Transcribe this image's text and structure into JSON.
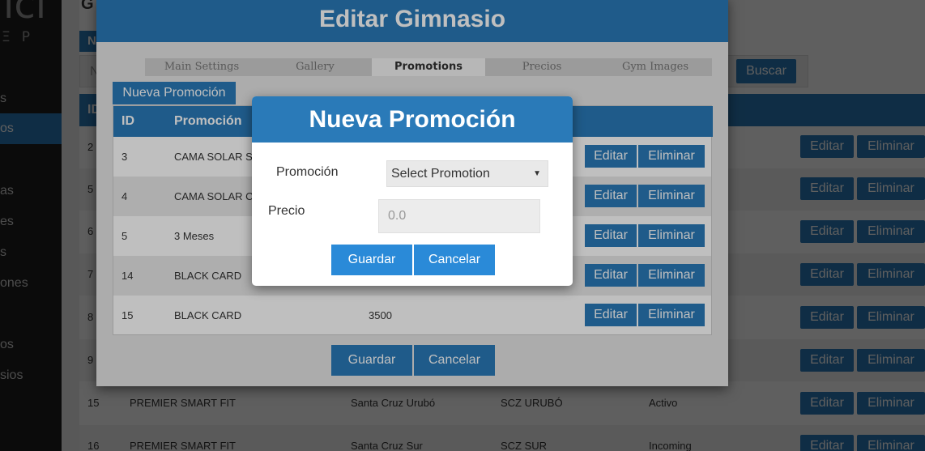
{
  "background": {
    "title": "G",
    "filter_button": "N",
    "filter_placeholder": "N",
    "search_label": "Buscar",
    "table_header_id": "ID",
    "sidebar_items": [
      "s",
      "os",
      "as",
      "es",
      "s",
      "ones",
      "os",
      "sios"
    ],
    "rows": [
      {
        "id": "2",
        "name": "",
        "city": "",
        "code": "",
        "status": ""
      },
      {
        "id": "5",
        "name": "",
        "city": "",
        "code": "",
        "status": ""
      },
      {
        "id": "6",
        "name": "",
        "city": "",
        "code": "",
        "status": ""
      },
      {
        "id": "7",
        "name": "",
        "city": "",
        "code": "",
        "status": ""
      },
      {
        "id": "8",
        "name": "",
        "city": "",
        "code": "",
        "status": ""
      },
      {
        "id": "9",
        "name": "",
        "city": "",
        "code": "",
        "status": ""
      },
      {
        "id": "15",
        "name": "PREMIER SMART FIT",
        "city": "Santa Cruz Urubó",
        "code": "SCZ URUBÓ",
        "status": "Activo"
      },
      {
        "id": "16",
        "name": "PREMIER SMART FIT",
        "city": "Santa Cruz Sur",
        "code": "SCZ SUR",
        "status": "Incoming"
      }
    ],
    "edit_label": "Editar",
    "delete_label": "Eliminar"
  },
  "edit_modal": {
    "title": "Editar Gimnasio",
    "tabs": [
      "Main Settings",
      "Gallery",
      "Promotions",
      "Precios",
      "Gym Images"
    ],
    "active_tab": "Promotions",
    "new_button": "Nueva Promoción",
    "headers": {
      "id": "ID",
      "promo": "Promoción"
    },
    "rows": [
      {
        "id": "3",
        "promo": "CAMA SOLAR S",
        "price": ""
      },
      {
        "id": "4",
        "promo": "CAMA SOLAR C",
        "price": ""
      },
      {
        "id": "5",
        "promo": "3 Meses",
        "price": ""
      },
      {
        "id": "14",
        "promo": "BLACK CARD",
        "price": ""
      },
      {
        "id": "15",
        "promo": "BLACK CARD",
        "price": "3500"
      }
    ],
    "edit_label": "Editar",
    "delete_label": "Eliminar",
    "save_label": "Guardar",
    "cancel_label": "Cancelar"
  },
  "promo_modal": {
    "title": "Nueva Promoción",
    "promo_label": "Promoción",
    "promo_select_value": "Select Promotion",
    "price_label": "Precio",
    "price_placeholder": "0.0",
    "save_label": "Guardar",
    "cancel_label": "Cancelar"
  }
}
